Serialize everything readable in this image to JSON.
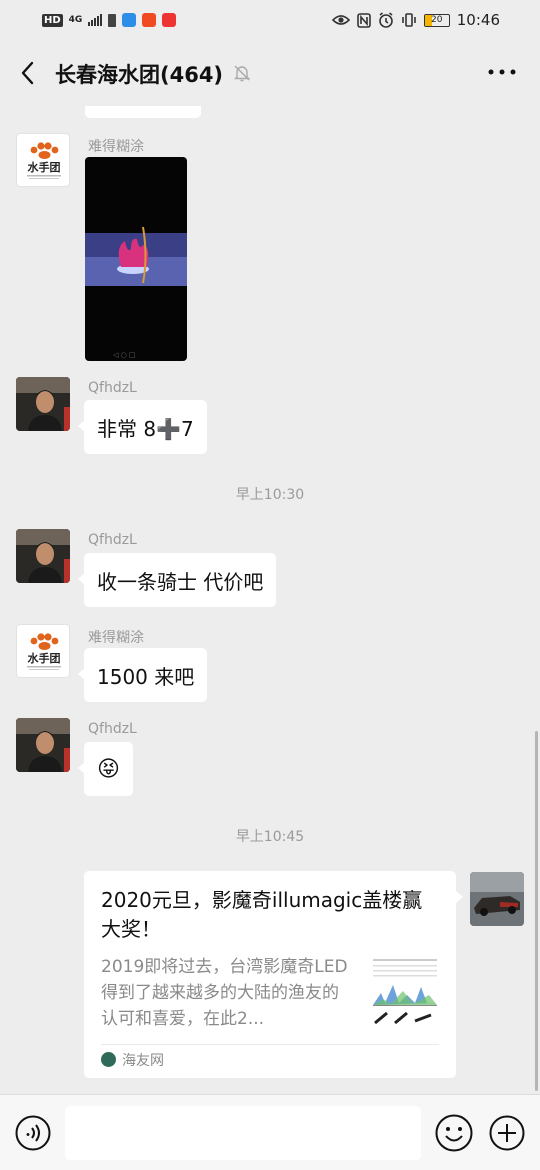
{
  "status_bar": {
    "hd": "HD",
    "network": "4G",
    "time": "10:46",
    "battery": "20"
  },
  "header": {
    "title": "长春海水团(464)"
  },
  "messages": {
    "m1": {
      "sender": "难得糊涂"
    },
    "m2": {
      "sender": "QfhdzL",
      "text": "非常 8➕7"
    },
    "t1": "早上10:30",
    "m3": {
      "sender": "QfhdzL",
      "text": "收一条骑士 代价吧"
    },
    "m4": {
      "sender": "难得糊涂",
      "text": "1500 来吧"
    },
    "m5": {
      "sender": "QfhdzL",
      "text": "😝"
    },
    "t2": "早上10:45"
  },
  "link_card": {
    "title": "2020元旦，影魔奇illumagic盖楼赢大奖！",
    "description": "2019即将过去，台湾影魔奇LED得到了越来越多的大陆的渔友的认可和喜爱，在此2...",
    "source": "海友网"
  },
  "logo_text": "水手团",
  "colors": {
    "chat_bg": "#ededed",
    "bubble": "#ffffff",
    "meta_text": "#9a9a9a",
    "input_bar": "#f7f7f7"
  },
  "icons": [
    "back-arrow-icon",
    "mute-bell-icon",
    "more-icon",
    "voice-icon",
    "emoji-icon",
    "plus-icon"
  ]
}
